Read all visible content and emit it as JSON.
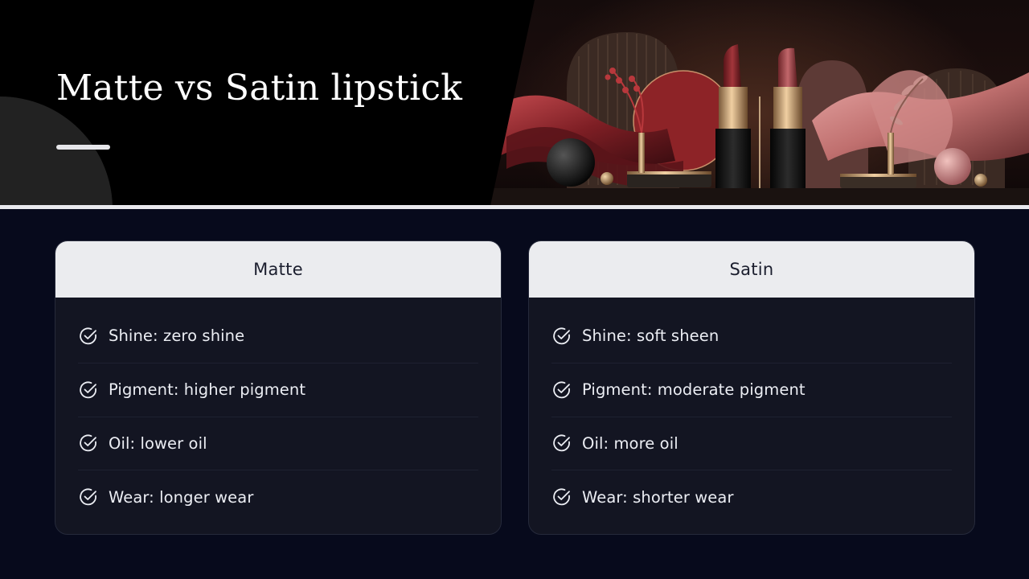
{
  "header": {
    "title": "Matte vs Satin lipstick"
  },
  "hero_image": {
    "description_icon": "lipstick-illustration"
  },
  "cards": [
    {
      "heading": "Matte",
      "items": [
        "Shine: zero shine",
        "Pigment: higher pigment",
        "Oil: lower oil",
        "Wear: longer wear"
      ]
    },
    {
      "heading": "Satin",
      "items": [
        "Shine: soft sheen",
        "Pigment: moderate pigment",
        "Oil: more oil",
        "Wear: shorter wear"
      ]
    }
  ],
  "colors": {
    "background": "#070a1c",
    "card_body": "#131522",
    "card_head": "#ebecef",
    "accent_lipstick_dark": "#8e2a2e",
    "accent_lipstick_light": "#b5555a"
  }
}
